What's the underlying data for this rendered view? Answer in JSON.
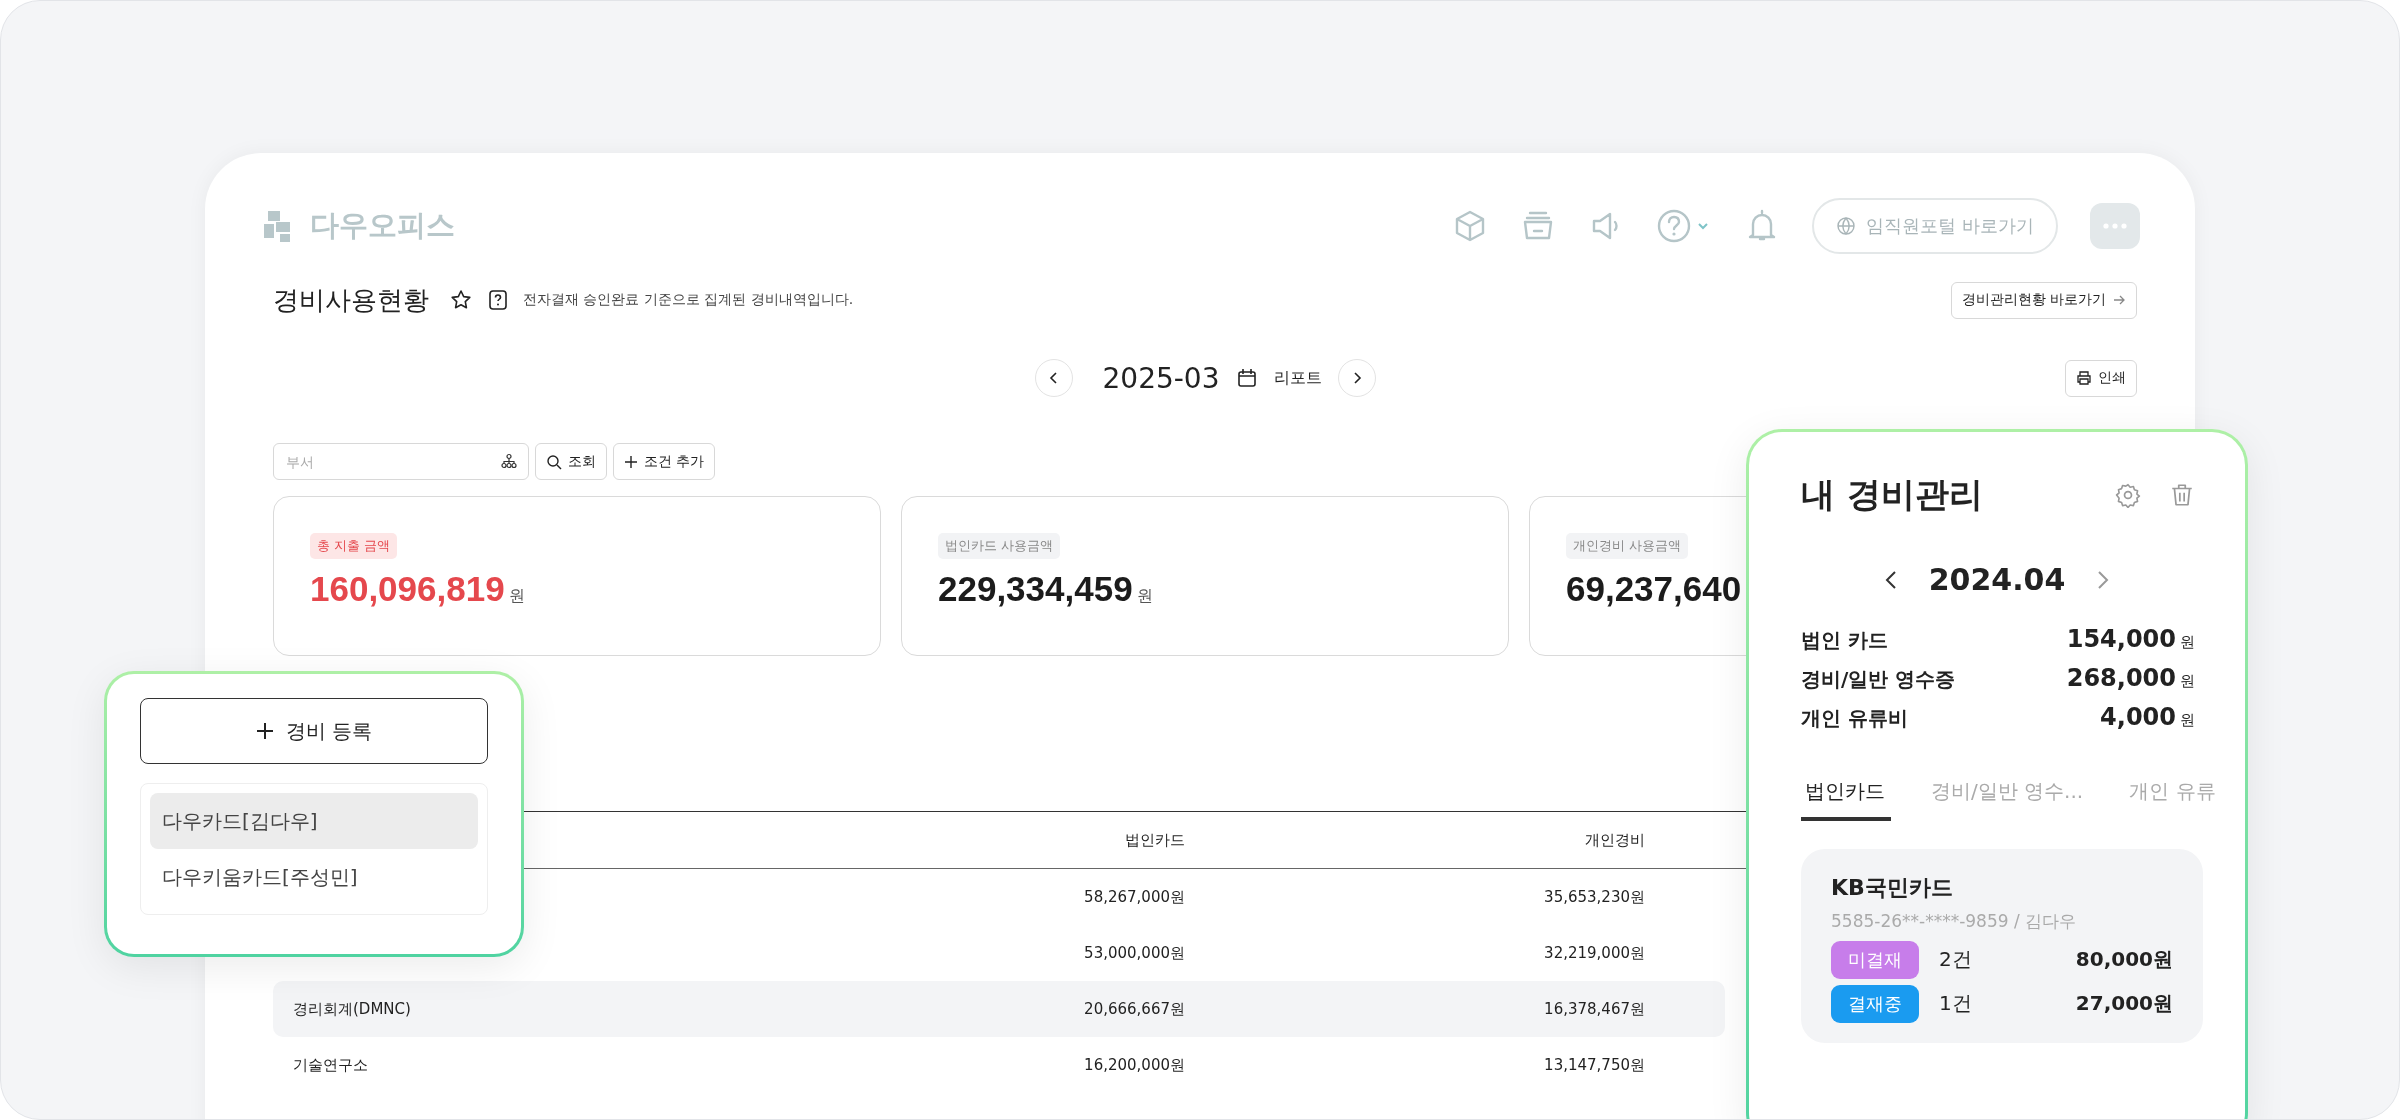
{
  "brand": {
    "name": "다우오피스"
  },
  "header": {
    "portal": "임직원포털 바로가기"
  },
  "page": {
    "title": "경비사용현황",
    "favorite": false,
    "description": "전자결재 승인완료 기준으로 집계된 경비내역입니다.",
    "shortcut": "경비관리현황 바로가기"
  },
  "period": {
    "value": "2025-03",
    "report": "리포트",
    "print": "인쇄"
  },
  "filter": {
    "placeholder": "부서",
    "search": "조회",
    "add": "조건 추가"
  },
  "cards": [
    {
      "kind": "total",
      "label": "총 지출 금액",
      "amount": "160,096,819",
      "unit": "원"
    },
    {
      "kind": "normal",
      "label": "법인카드 사용금액",
      "amount": "229,334,459",
      "unit": "원"
    },
    {
      "kind": "normal",
      "label": "개인경비 사용금액",
      "amount": "69,237,640"
    }
  ],
  "table": {
    "columns": [
      "법인카드",
      "개인경비"
    ],
    "rows": [
      {
        "corporate": "58,267,000원",
        "personal": "35,653,230원",
        "highlighted": false
      },
      {
        "corporate": "53,000,000원",
        "personal": "32,219,000원",
        "highlighted": false
      },
      {
        "name": "경리회계(DMNC)",
        "corporate": "20,666,667원",
        "personal": "16,378,467원",
        "highlighted": true
      },
      {
        "name": "기술연구소",
        "corporate": "16,200,000원",
        "personal": "13,147,750원",
        "highlighted": false
      }
    ]
  },
  "register": {
    "button": "경비 등록",
    "cards": [
      {
        "label": "다우카드[김다우]",
        "selected": true
      },
      {
        "label": "다우키움카드[주성민]",
        "selected": false
      }
    ]
  },
  "my_expense": {
    "title": "내 경비관리",
    "month": "2024.04",
    "summary": [
      {
        "label": "법인 카드",
        "amount": "154,000",
        "unit": "원"
      },
      {
        "label": "경비/일반 영수증",
        "amount": "268,000",
        "unit": "원"
      },
      {
        "label": "개인 유류비",
        "amount": "4,000",
        "unit": "원"
      }
    ],
    "tabs": [
      {
        "label": "법인카드",
        "selected": true
      },
      {
        "label": "경비/일반 영수...",
        "selected": false
      },
      {
        "label": "개인 유류",
        "selected": false
      }
    ],
    "card": {
      "name": "KB국민카드",
      "number": "5585-26**-****-9859 / 김다우",
      "statuses": [
        {
          "label": "미결재",
          "color": "#c77dea",
          "count": "2건",
          "amount": "80,000원"
        },
        {
          "label": "결재중",
          "color": "#1a9bf0",
          "count": "1건",
          "amount": "27,000원"
        }
      ]
    }
  }
}
